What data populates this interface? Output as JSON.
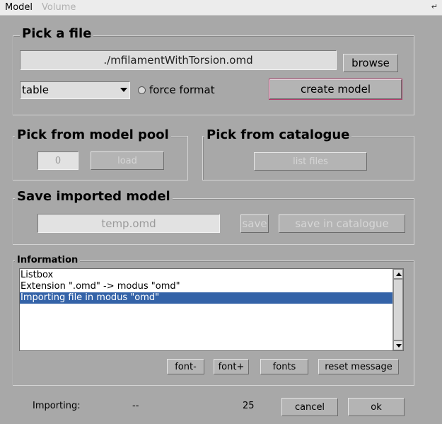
{
  "menu": {
    "tab_model": "Model",
    "tab_volume": "Volume",
    "corner_icon": "resize-corner-icon"
  },
  "pick_file": {
    "title": "Pick a file",
    "file_path": "./mfilamentWithTorsion.omd",
    "browse_label": "browse",
    "format_selected": "table",
    "force_format_label": "force format",
    "create_model_label": "create model"
  },
  "model_pool": {
    "title": "Pick from model pool",
    "index_value": "0",
    "load_label": "load"
  },
  "catalogue": {
    "title": "Pick from catalogue",
    "list_files_label": "list files"
  },
  "save_model": {
    "title": "Save imported model",
    "filename_value": "temp.omd",
    "save_label": "save",
    "save_catalogue_label": "save in catalogue"
  },
  "information": {
    "title": "Information",
    "lines": [
      "Listbox",
      "Extension \".omd\" -> modus \"omd\"",
      "Importing file in modus \"omd\""
    ],
    "selected_index": 2,
    "font_minus_label": "font-",
    "font_plus_label": "font+",
    "fonts_label": "fonts",
    "reset_message_label": "reset message"
  },
  "status": {
    "label": "Importing:",
    "value": "--",
    "count": "25",
    "cancel_label": "cancel",
    "ok_label": "ok"
  },
  "colors": {
    "background": "#a8a8a8",
    "selection": "#3463a8",
    "focus_border": "#b03a6a"
  }
}
